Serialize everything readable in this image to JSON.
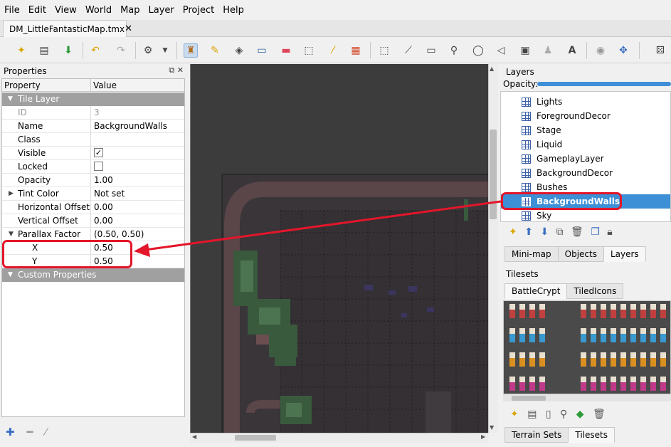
{
  "menu": [
    "File",
    "Edit",
    "View",
    "World",
    "Map",
    "Layer",
    "Project",
    "Help"
  ],
  "document_tab": {
    "title": "DM_LittleFantasticMap.tmx",
    "close": "✕"
  },
  "properties": {
    "title": "Properties",
    "header_property": "Property",
    "header_value": "Value",
    "rows": [
      {
        "type": "group",
        "label": "Tile Layer",
        "value": ""
      },
      {
        "type": "disabled",
        "label": "ID",
        "value": "3"
      },
      {
        "type": "text",
        "label": "Name",
        "value": "BackgroundWalls"
      },
      {
        "type": "text",
        "label": "Class",
        "value": ""
      },
      {
        "type": "checkbox",
        "label": "Visible",
        "value": "✓"
      },
      {
        "type": "checkbox",
        "label": "Locked",
        "value": ""
      },
      {
        "type": "text",
        "label": "Opacity",
        "value": "1.00"
      },
      {
        "type": "expand",
        "label": "Tint Color",
        "value": "Not set"
      },
      {
        "type": "text",
        "label": "Horizontal Offset",
        "value": "0.00"
      },
      {
        "type": "text",
        "label": "Vertical Offset",
        "value": "0.00"
      },
      {
        "type": "expanded",
        "label": "Parallax Factor",
        "value": "(0.50, 0.50)"
      },
      {
        "type": "sub",
        "label": "X",
        "value": "0.50"
      },
      {
        "type": "sub",
        "label": "Y",
        "value": "0.50"
      },
      {
        "type": "group",
        "label": "Custom Properties",
        "value": ""
      }
    ]
  },
  "layers": {
    "title": "Layers",
    "opacity_label": "Opacity:",
    "opacity_value": 1.0,
    "items": [
      "Lights",
      "ForegroundDecor",
      "Stage",
      "Liquid",
      "GameplayLayer",
      "BackgroundDecor",
      "Bushes",
      "BackgroundWalls",
      "Sky"
    ],
    "selected": "BackgroundWalls",
    "tabs": [
      "Mini-map",
      "Objects",
      "Layers"
    ],
    "active_tab": "Layers"
  },
  "tilesets": {
    "title": "Tilesets",
    "tabs": [
      "BattleCrypt",
      "TiledIcons"
    ],
    "active_tab": "BattleCrypt",
    "bottom_tabs": [
      "Terrain Sets",
      "Tilesets"
    ],
    "active_bottom_tab": "Tilesets"
  },
  "colors": {
    "accent": "#3d8fd6",
    "annotation": "#e3162a",
    "group_header": "#a0a0a0"
  }
}
